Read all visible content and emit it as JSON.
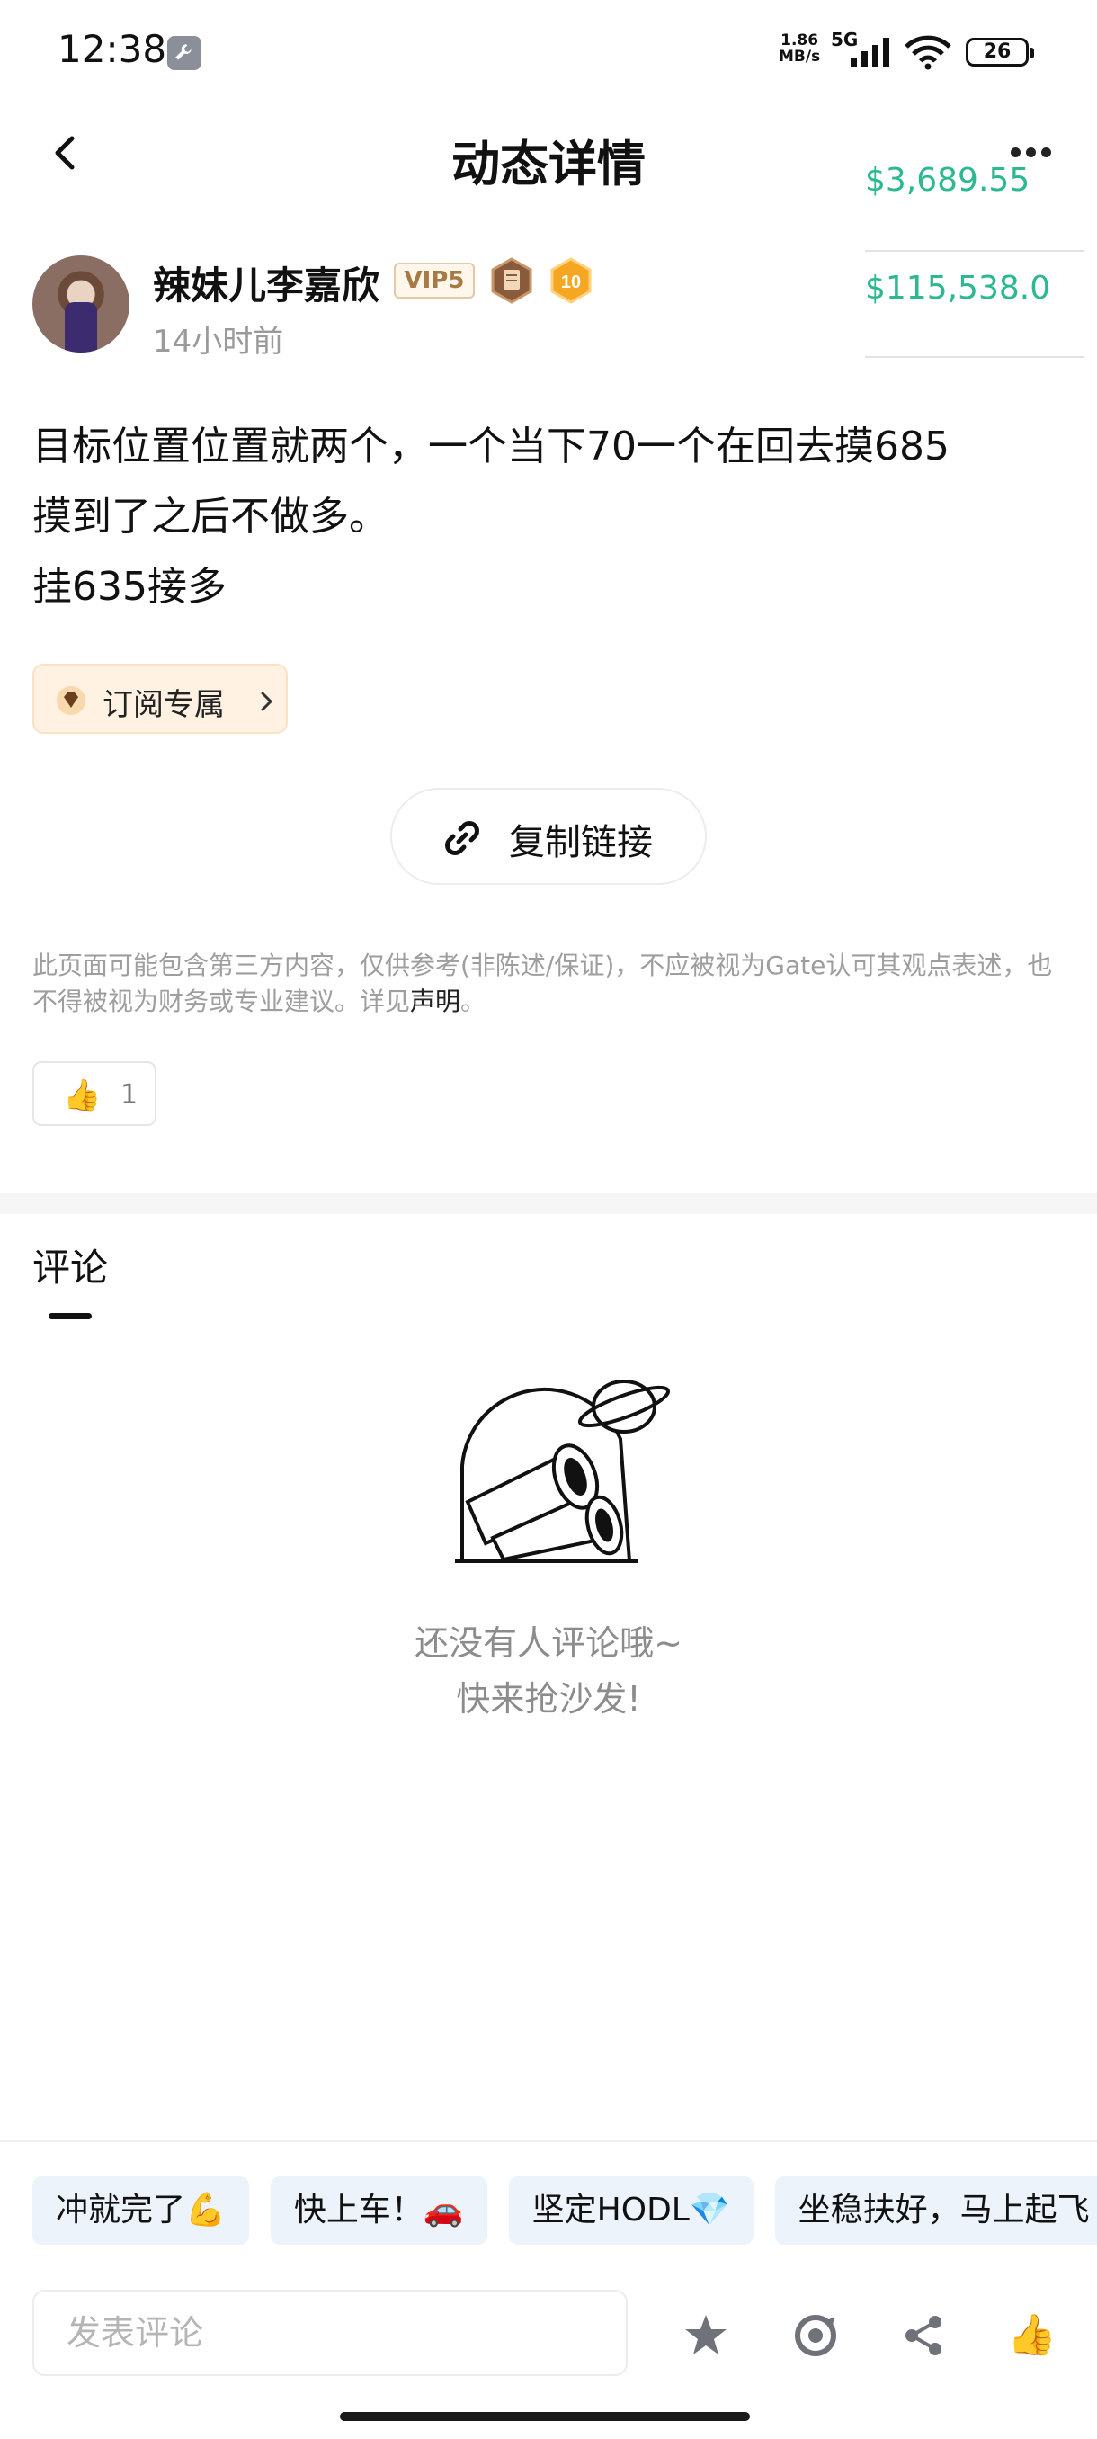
{
  "status_bar": {
    "time": "12:38",
    "net_speed_value": "1.86",
    "net_speed_unit": "MB/s",
    "network": "5G",
    "battery": "26"
  },
  "header": {
    "title": "动态详情"
  },
  "floating_prices": {
    "price_1": "$3,689.55",
    "price_2": "$115,538.0",
    "color": "#2bb892"
  },
  "post": {
    "author_name": "辣妹儿李嘉欣",
    "vip_badge": "VIP5",
    "level_badge": "10",
    "time": "14小时前",
    "content_line1": "目标位置位置就两个，一个当下70一个在回去摸685",
    "content_line2": "摸到了之后不做多。",
    "content_line3": "挂635接多",
    "subscribe_tag": "订阅专属",
    "copy_link": "复制链接",
    "disclaimer_text": "此页面可能包含第三方内容，仅供参考(非陈述/保证)，不应被视为Gate认可其观点表述，也不得被视为财务或专业建议。详见",
    "disclaimer_link": "声明",
    "disclaimer_end": "。",
    "like_emoji": "👍",
    "like_count": "1"
  },
  "comments": {
    "title": "评论",
    "empty_line1": "还没有人评论哦~",
    "empty_line2": "快来抢沙发!"
  },
  "quick_replies": [
    "冲就完了💪",
    "快上车！🚗",
    "坚定HODL💎",
    "坐稳扶好，马上起飞"
  ],
  "bottom_bar": {
    "input_placeholder": "发表评论",
    "icons": [
      "star-icon",
      "repost-icon",
      "share-icon",
      "thumbs-up-icon"
    ]
  }
}
